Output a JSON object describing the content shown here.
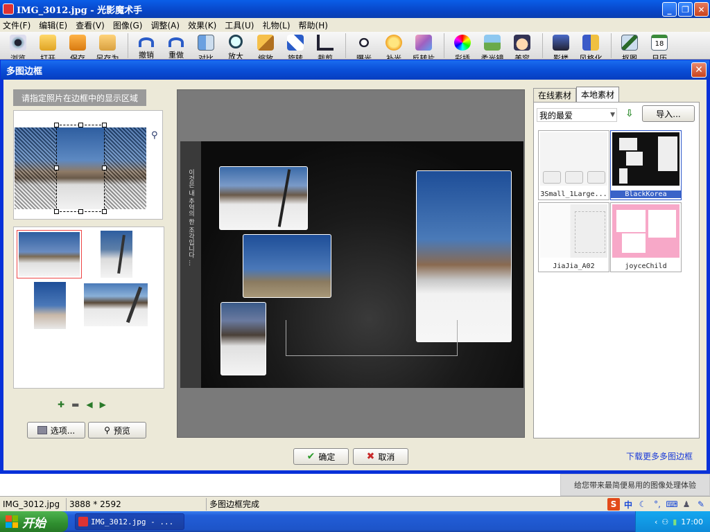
{
  "window": {
    "title": "IMG_3012.jpg - 光影魔术手"
  },
  "menu": [
    "文件(F)",
    "编辑(E)",
    "查看(V)",
    "图像(G)",
    "调整(A)",
    "效果(K)",
    "工具(U)",
    "礼物(L)",
    "帮助(H)"
  ],
  "toolbar": [
    "浏览",
    "打开",
    "保存",
    "另存为",
    "撤销",
    "重做",
    "对比",
    "放大",
    "缩放",
    "旋转",
    "裁剪",
    "曝光",
    "补光",
    "反转片",
    "彩插",
    "柔光镜",
    "美容",
    "影楼",
    "风格化",
    "抠图",
    "日历"
  ],
  "calendar_day": "18",
  "dialog": {
    "title": "多图边框",
    "region_hint": "请指定照片在边框中的显示区域",
    "options_btn": "选项...",
    "preview_btn": "预览",
    "ok_btn": "确定",
    "cancel_btn": "取消",
    "download_link": "下载更多多图边框",
    "vertical_text": "이것은 내 추억의 한 조각입니다 ..."
  },
  "library": {
    "tabs": [
      "在线素材",
      "本地素材"
    ],
    "active_tab": 1,
    "category": "我的最爱",
    "import_btn": "导入...",
    "items": [
      {
        "label": "3Small_1Large..."
      },
      {
        "label": "BlackKorea"
      },
      {
        "label": "JiaJia_A02"
      },
      {
        "label": "joyceChild"
      }
    ],
    "selected": 1
  },
  "notice": "给您带来最简便易用的图像处理体验",
  "status": {
    "filename": "IMG_3012.jpg",
    "dimensions": "3888 * 2592",
    "message": "多图边框完成"
  },
  "taskbar": {
    "start": "开始",
    "task": "IMG_3012.jpg - ...",
    "time": "17:00"
  },
  "colors": {
    "title_blue": "#0a5ee8",
    "selection_blue": "#3a63c8",
    "thumb_border_red": "#e44444"
  }
}
